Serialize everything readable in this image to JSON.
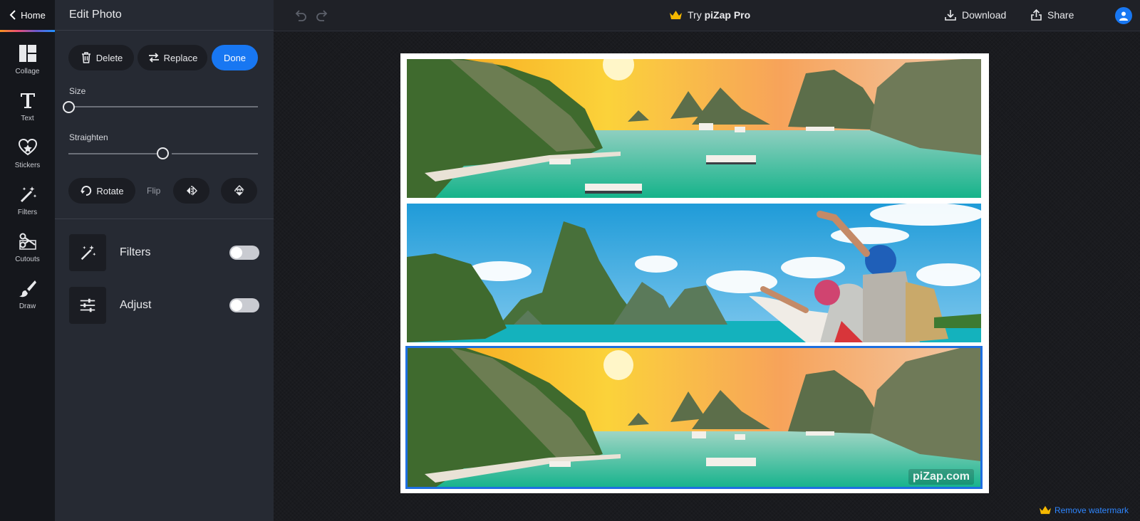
{
  "rail": {
    "home_label": "Home",
    "items": [
      {
        "label": "Collage",
        "icon": "collage-icon"
      },
      {
        "label": "Text",
        "icon": "text-icon"
      },
      {
        "label": "Stickers",
        "icon": "sticker-icon"
      },
      {
        "label": "Filters",
        "icon": "magic-wand-icon"
      },
      {
        "label": "Cutouts",
        "icon": "scissors-icon"
      },
      {
        "label": "Draw",
        "icon": "brush-icon"
      }
    ]
  },
  "panel": {
    "title": "Edit Photo",
    "delete_label": "Delete",
    "replace_label": "Replace",
    "done_label": "Done",
    "size_label": "Size",
    "size_value": 0,
    "straighten_label": "Straighten",
    "straighten_value": 0.5,
    "rotate_label": "Rotate",
    "flip_label": "Flip",
    "tools": [
      {
        "label": "Filters",
        "icon": "magic-wand-icon",
        "enabled": false
      },
      {
        "label": "Adjust",
        "icon": "sliders-icon",
        "enabled": false
      }
    ]
  },
  "topbar": {
    "try_prefix": "Try ",
    "try_brand": "piZap Pro",
    "download_label": "Download",
    "share_label": "Share"
  },
  "canvas": {
    "watermark": "piZap.com",
    "remove_watermark_label": "Remove watermark",
    "selected_photo": 3
  },
  "colors": {
    "accent": "#1877f2",
    "crown": "#f5b800",
    "selection": "#1e6fe0"
  }
}
